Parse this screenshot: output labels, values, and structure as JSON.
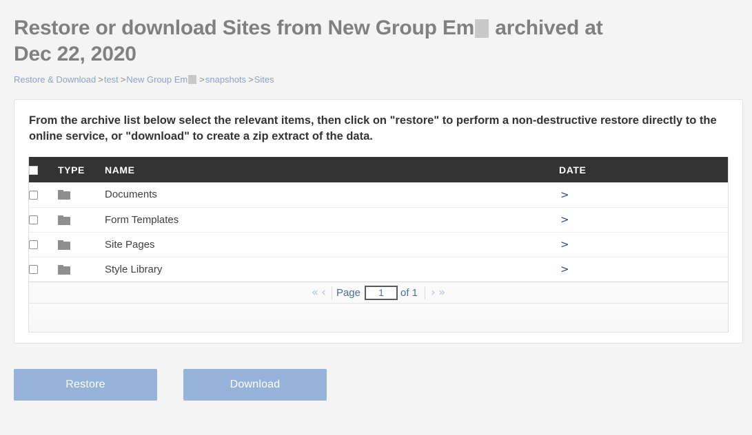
{
  "header": {
    "title_part1": "Restore or download Sites from New Group Em",
    "title_redacted": true,
    "title_part2": " archived at",
    "title_line2": "Dec 22, 2020",
    "title_color": "#808080"
  },
  "breadcrumb": {
    "items": [
      {
        "label": "Restore & Download",
        "link": true
      },
      {
        "label": "test",
        "link": true
      },
      {
        "label": "New Group Em",
        "link": true,
        "redacted": true
      },
      {
        "label": "snapshots",
        "link": true
      },
      {
        "label": "Sites",
        "link": true
      }
    ],
    "separator": ">"
  },
  "card": {
    "intro": "From the archive list below select the relevant items, then click on \"restore\" to perform a non-destructive restore directly to the online service, or \"download\" to create a zip extract of the data."
  },
  "table": {
    "columns": [
      "",
      "TYPE",
      "NAME",
      "DATE"
    ],
    "select_all_checked": false,
    "rows": [
      {
        "checked": false,
        "type_icon": "folder-icon",
        "name": "Documents",
        "date": ">"
      },
      {
        "checked": false,
        "type_icon": "folder-icon",
        "name": "Form Templates",
        "date": ">"
      },
      {
        "checked": false,
        "type_icon": "folder-icon",
        "name": "Site Pages",
        "date": ">"
      },
      {
        "checked": false,
        "type_icon": "folder-icon",
        "name": "Style Library",
        "date": ">"
      }
    ]
  },
  "pagination": {
    "first_label": "«",
    "prev_label": "‹",
    "page_label": "Page",
    "page_value": "1",
    "of_label": "of 1",
    "next_label": "›",
    "last_label": "»"
  },
  "actions": {
    "restore_label": "Restore",
    "download_label": "Download",
    "button_color": "#96b3d9"
  },
  "colors": {
    "page_background": "#f4f4f4",
    "card_background": "#ffffff",
    "table_header_background": "#333333",
    "link": "#8aa4c8",
    "folder": "#8e8e8e",
    "redaction": "#c8c8c8"
  }
}
